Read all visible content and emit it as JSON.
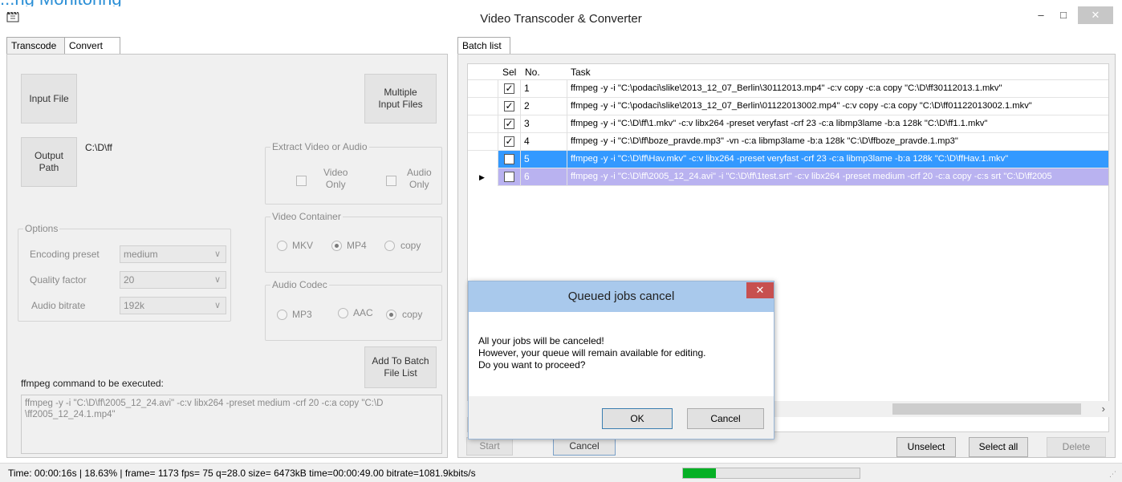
{
  "window": {
    "title": "Video Transcoder & Converter",
    "min_glyph": "–",
    "max_glyph": "□",
    "close_glyph": "✕"
  },
  "heading_cut": "...ng Monitoring",
  "left": {
    "tabs": [
      "Transcode",
      "Convert"
    ],
    "active_tab": "Convert",
    "input_file_label": "Input File",
    "multiple_input_label_1": "Multiple",
    "multiple_input_label_2": "Input Files",
    "output_path_label_1": "Output",
    "output_path_label_2": "Path",
    "output_path_value": "C:\\D\\ff",
    "extract": {
      "title": "Extract Video or Audio",
      "video_1": "Video",
      "video_2": "Only",
      "audio_1": "Audio",
      "audio_2": "Only"
    },
    "container": {
      "title": "Video Container",
      "options": [
        "MKV",
        "MP4",
        "copy"
      ],
      "selected": "MP4"
    },
    "audio_codec": {
      "title": "Audio Codec",
      "options": [
        "MP3",
        "AAC",
        "copy"
      ],
      "selected": "copy"
    },
    "options": {
      "title": "Options",
      "encoding_preset_label": "Encoding preset",
      "encoding_preset_value": "medium",
      "quality_label": "Quality factor",
      "quality_value": "20",
      "bitrate_label": "Audio bitrate",
      "bitrate_value": "192k"
    },
    "add_batch_1": "Add To Batch",
    "add_batch_2": "File List",
    "cmd_label": "ffmpeg command to be executed:",
    "cmd_line_1": "ffmpeg -y -i \"C:\\D\\ff\\2005_12_24.avi\" -c:v libx264 -preset medium -crf 20 -c:a copy \"C:\\D",
    "cmd_line_2": "\\ff2005_12_24.1.mp4\""
  },
  "right": {
    "tab": "Batch list",
    "headers": {
      "sel": "Sel",
      "no": "No.",
      "task": "Task"
    },
    "rows": [
      {
        "checked": true,
        "no": "1",
        "task": "ffmpeg -y -i \"C:\\podaci\\slike\\2013_12_07_Berlin\\30112013.mp4\" -c:v copy -c:a copy \"C:\\D\\ff30112013.1.mkv\""
      },
      {
        "checked": true,
        "no": "2",
        "task": "ffmpeg -y -i \"C:\\podaci\\slike\\2013_12_07_Berlin\\01122013002.mp4\" -c:v copy -c:a copy \"C:\\D\\ff01122013002.1.mkv\""
      },
      {
        "checked": true,
        "no": "3",
        "task": "ffmpeg -y -i \"C:\\D\\ff\\1.mkv\" -c:v libx264 -preset veryfast -crf 23 -c:a libmp3lame -b:a 128k \"C:\\D\\ff1.1.mkv\""
      },
      {
        "checked": true,
        "no": "4",
        "task": "ffmpeg -y -i \"C:\\D\\ff\\boze_pravde.mp3\" -vn -c:a libmp3lame -b:a 128k \"C:\\D\\ffboze_pravde.1.mp3\""
      },
      {
        "checked": false,
        "no": "5",
        "task": "ffmpeg -y -i \"C:\\D\\ff\\Hav.mkv\" -c:v libx264 -preset veryfast -crf 23 -c:a libmp3lame -b:a 128k \"C:\\D\\ffHav.1.mkv\""
      },
      {
        "checked": false,
        "no": "6",
        "task": "ffmpeg -y -i \"C:\\D\\ff\\2005_12_24.avi\" -i \"C:\\D\\ff\\1test.srt\" -c:v libx264 -preset medium -crf 20 -c:a copy -c:s srt \"C:\\D\\ff2005"
      }
    ],
    "check_glyph": "✓",
    "pointer_glyph": "▶",
    "scroll_arrow": "›",
    "start_label": "Start",
    "cancel_label": "Cancel",
    "unselect_label": "Unselect",
    "select_all_label": "Select all",
    "delete_label": "Delete"
  },
  "dialog": {
    "title": "Queued jobs cancel",
    "close_glyph": "✕",
    "line_1": "All your jobs will be canceled!",
    "line_2": "However, your queue will remain available for editing.",
    "line_3": "Do you want to proceed?",
    "ok_label": "OK",
    "cancel_label": "Cancel"
  },
  "status": {
    "text": "Time: 00:00:16s  |  18.63%   |  frame= 1173 fps= 75 q=28.0 size=    6473kB time=00:00:49.00 bitrate=1081.9kbits/s",
    "progress_percent": 18.63,
    "grip": "⋰"
  }
}
